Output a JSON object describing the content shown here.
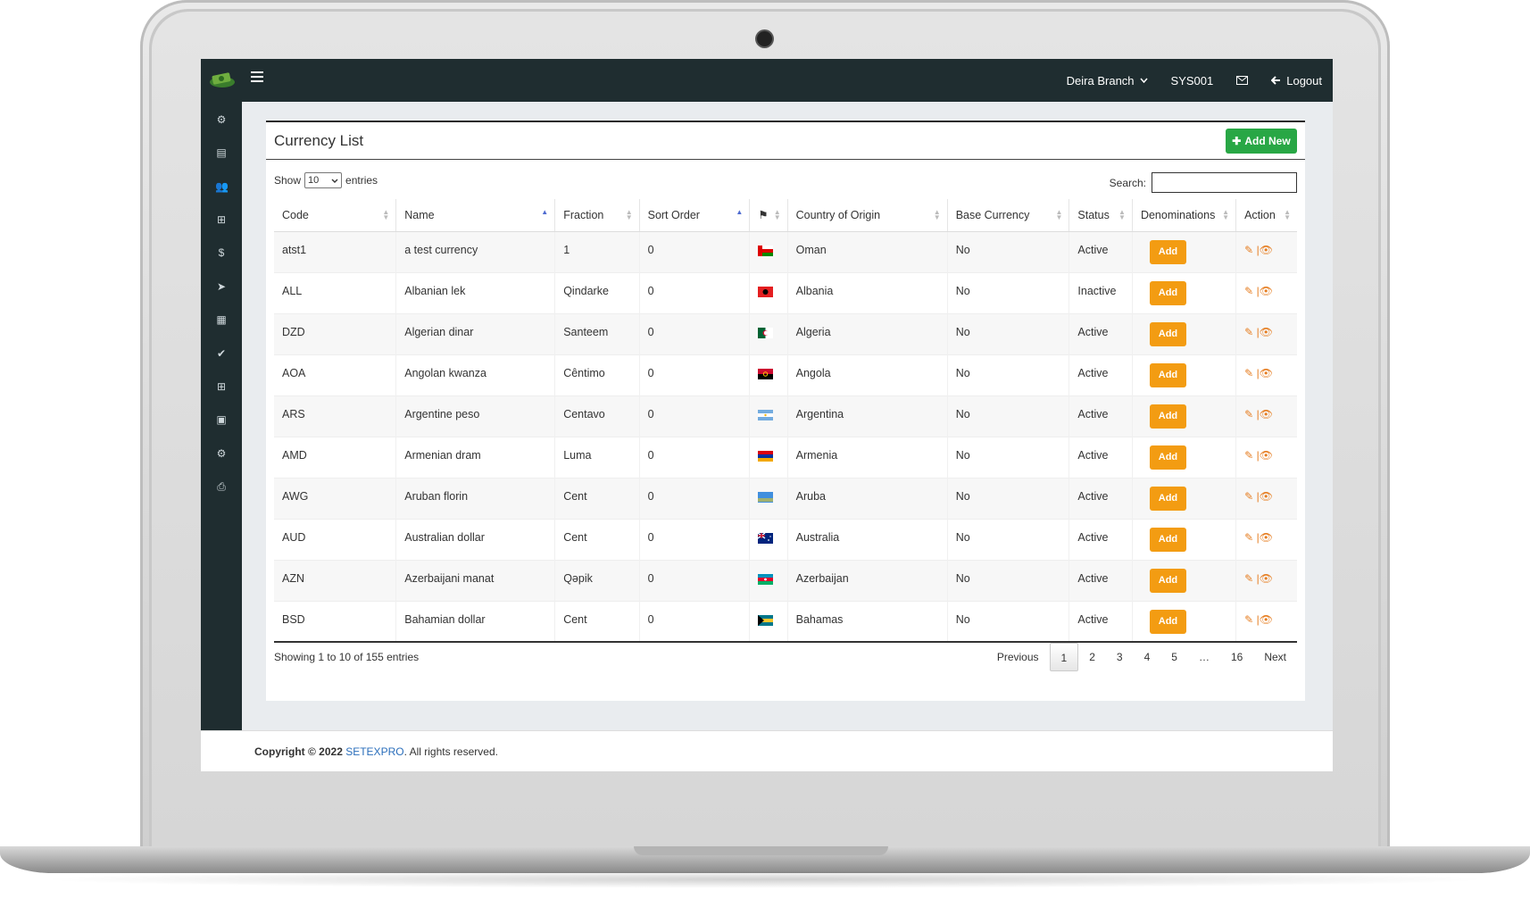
{
  "topbar": {
    "branch": "Deira Branch",
    "user": "SYS001",
    "logout": "Logout"
  },
  "sidebar": {
    "icons": [
      "gear-icon",
      "list-icon",
      "users-icon",
      "plus-square-icon",
      "dollar-icon",
      "send-icon",
      "table-icon",
      "check-icon",
      "plus-square-icon",
      "money-icon",
      "gear-icon",
      "print-icon"
    ]
  },
  "page": {
    "title": "Currency List",
    "add_new": "Add New"
  },
  "table_controls": {
    "show_label": "Show",
    "entries_value": "10",
    "entries_label": "entries",
    "search_label": "Search:"
  },
  "table": {
    "headers": [
      "Code",
      "Name",
      "Fraction",
      "Sort Order",
      "",
      "Country of Origin",
      "Base Currency",
      "Status",
      "Denominations",
      "Action"
    ],
    "rows": [
      {
        "code": "atst1",
        "name": "a test currency",
        "fraction": "1",
        "sort": "0",
        "country": "Oman",
        "base": "No",
        "status": "Active",
        "flag": "oman"
      },
      {
        "code": "ALL",
        "name": "Albanian lek",
        "fraction": "Qindarke",
        "sort": "0",
        "country": "Albania",
        "base": "No",
        "status": "Inactive",
        "flag": "albania"
      },
      {
        "code": "DZD",
        "name": "Algerian dinar",
        "fraction": "Santeem",
        "sort": "0",
        "country": "Algeria",
        "base": "No",
        "status": "Active",
        "flag": "algeria"
      },
      {
        "code": "AOA",
        "name": "Angolan kwanza",
        "fraction": "Cêntimo",
        "sort": "0",
        "country": "Angola",
        "base": "No",
        "status": "Active",
        "flag": "angola"
      },
      {
        "code": "ARS",
        "name": "Argentine peso",
        "fraction": "Centavo",
        "sort": "0",
        "country": "Argentina",
        "base": "No",
        "status": "Active",
        "flag": "argentina"
      },
      {
        "code": "AMD",
        "name": "Armenian dram",
        "fraction": "Luma",
        "sort": "0",
        "country": "Armenia",
        "base": "No",
        "status": "Active",
        "flag": "armenia"
      },
      {
        "code": "AWG",
        "name": "Aruban florin",
        "fraction": "Cent",
        "sort": "0",
        "country": "Aruba",
        "base": "No",
        "status": "Active",
        "flag": "aruba"
      },
      {
        "code": "AUD",
        "name": "Australian dollar",
        "fraction": "Cent",
        "sort": "0",
        "country": "Australia",
        "base": "No",
        "status": "Active",
        "flag": "australia"
      },
      {
        "code": "AZN",
        "name": "Azerbaijani manat",
        "fraction": "Qəpik",
        "sort": "0",
        "country": "Azerbaijan",
        "base": "No",
        "status": "Active",
        "flag": "azerbaijan"
      },
      {
        "code": "BSD",
        "name": "Bahamian dollar",
        "fraction": "Cent",
        "sort": "0",
        "country": "Bahamas",
        "base": "No",
        "status": "Active",
        "flag": "bahamas"
      }
    ],
    "add_label": "Add"
  },
  "footer_info": {
    "showing": "Showing 1 to 10 of 155 entries"
  },
  "pagination": {
    "previous": "Previous",
    "pages": [
      "1",
      "2",
      "3",
      "4",
      "5",
      "…",
      "16"
    ],
    "next": "Next"
  },
  "footer": {
    "copyright": "Copyright © 2022",
    "brand": "SETEXPRO",
    "rights": ". All rights reserved."
  },
  "colors": {
    "topbar": "#1f2d30",
    "add_new_button": "#28a745",
    "add_button": "#f39c12",
    "brand_link": "#2a6ebb"
  }
}
